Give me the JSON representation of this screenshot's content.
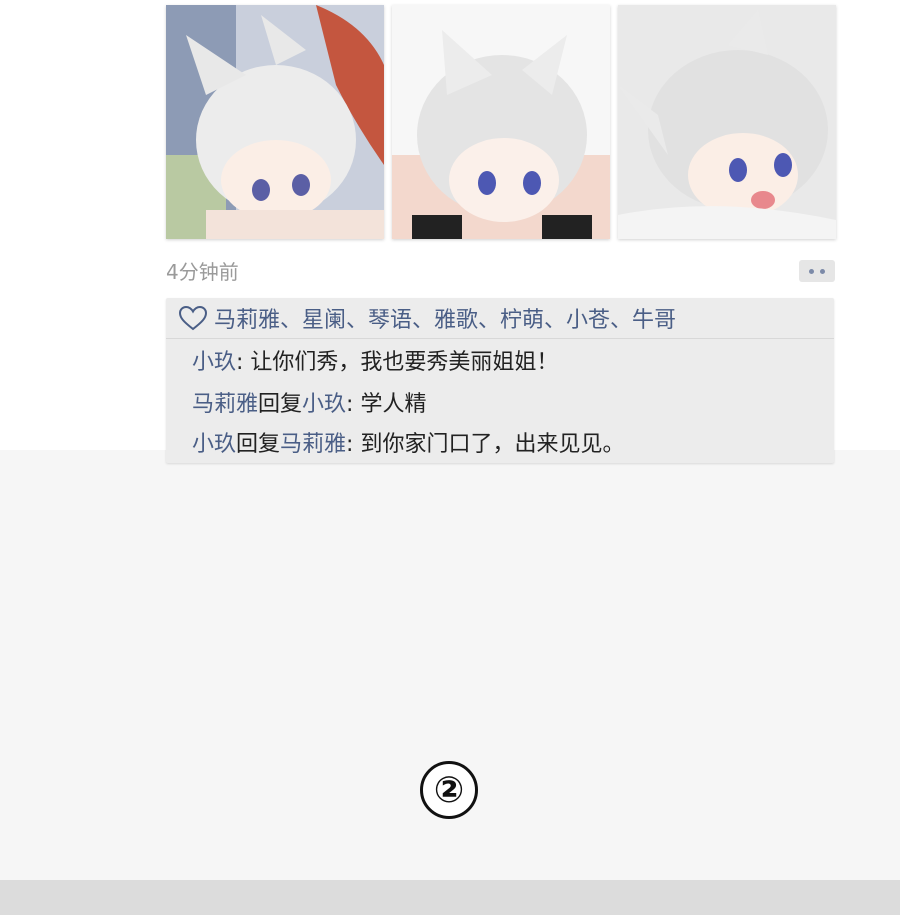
{
  "moment": {
    "photos": [
      {
        "icon": "anime-character-image"
      },
      {
        "icon": "anime-character-image"
      },
      {
        "icon": "anime-character-image"
      }
    ],
    "timestamp": "4分钟前",
    "more_icon": "more-dots-icon"
  },
  "likes": {
    "icon": "heart-icon",
    "text": "马莉雅、星阑、琴语、雅歌、柠萌、小苍、牛哥"
  },
  "comments": [
    {
      "author": "小玖",
      "reply_label": "",
      "reply_to": "",
      "separator": ": ",
      "text": "让你们秀，我也要秀美丽姐姐！"
    },
    {
      "author": "马莉雅",
      "reply_label": "回复",
      "reply_to": "小玖",
      "separator": ": ",
      "text": "学人精"
    },
    {
      "author": "小玖",
      "reply_label": "回复",
      "reply_to": "马莉雅",
      "separator": ": ",
      "text": "到你家门口了，出来见见。"
    }
  ],
  "page_number": "②",
  "colors": {
    "name_link": "#4a5e86",
    "comment_bg": "#ececec",
    "timestamp": "#9a9a9a"
  }
}
